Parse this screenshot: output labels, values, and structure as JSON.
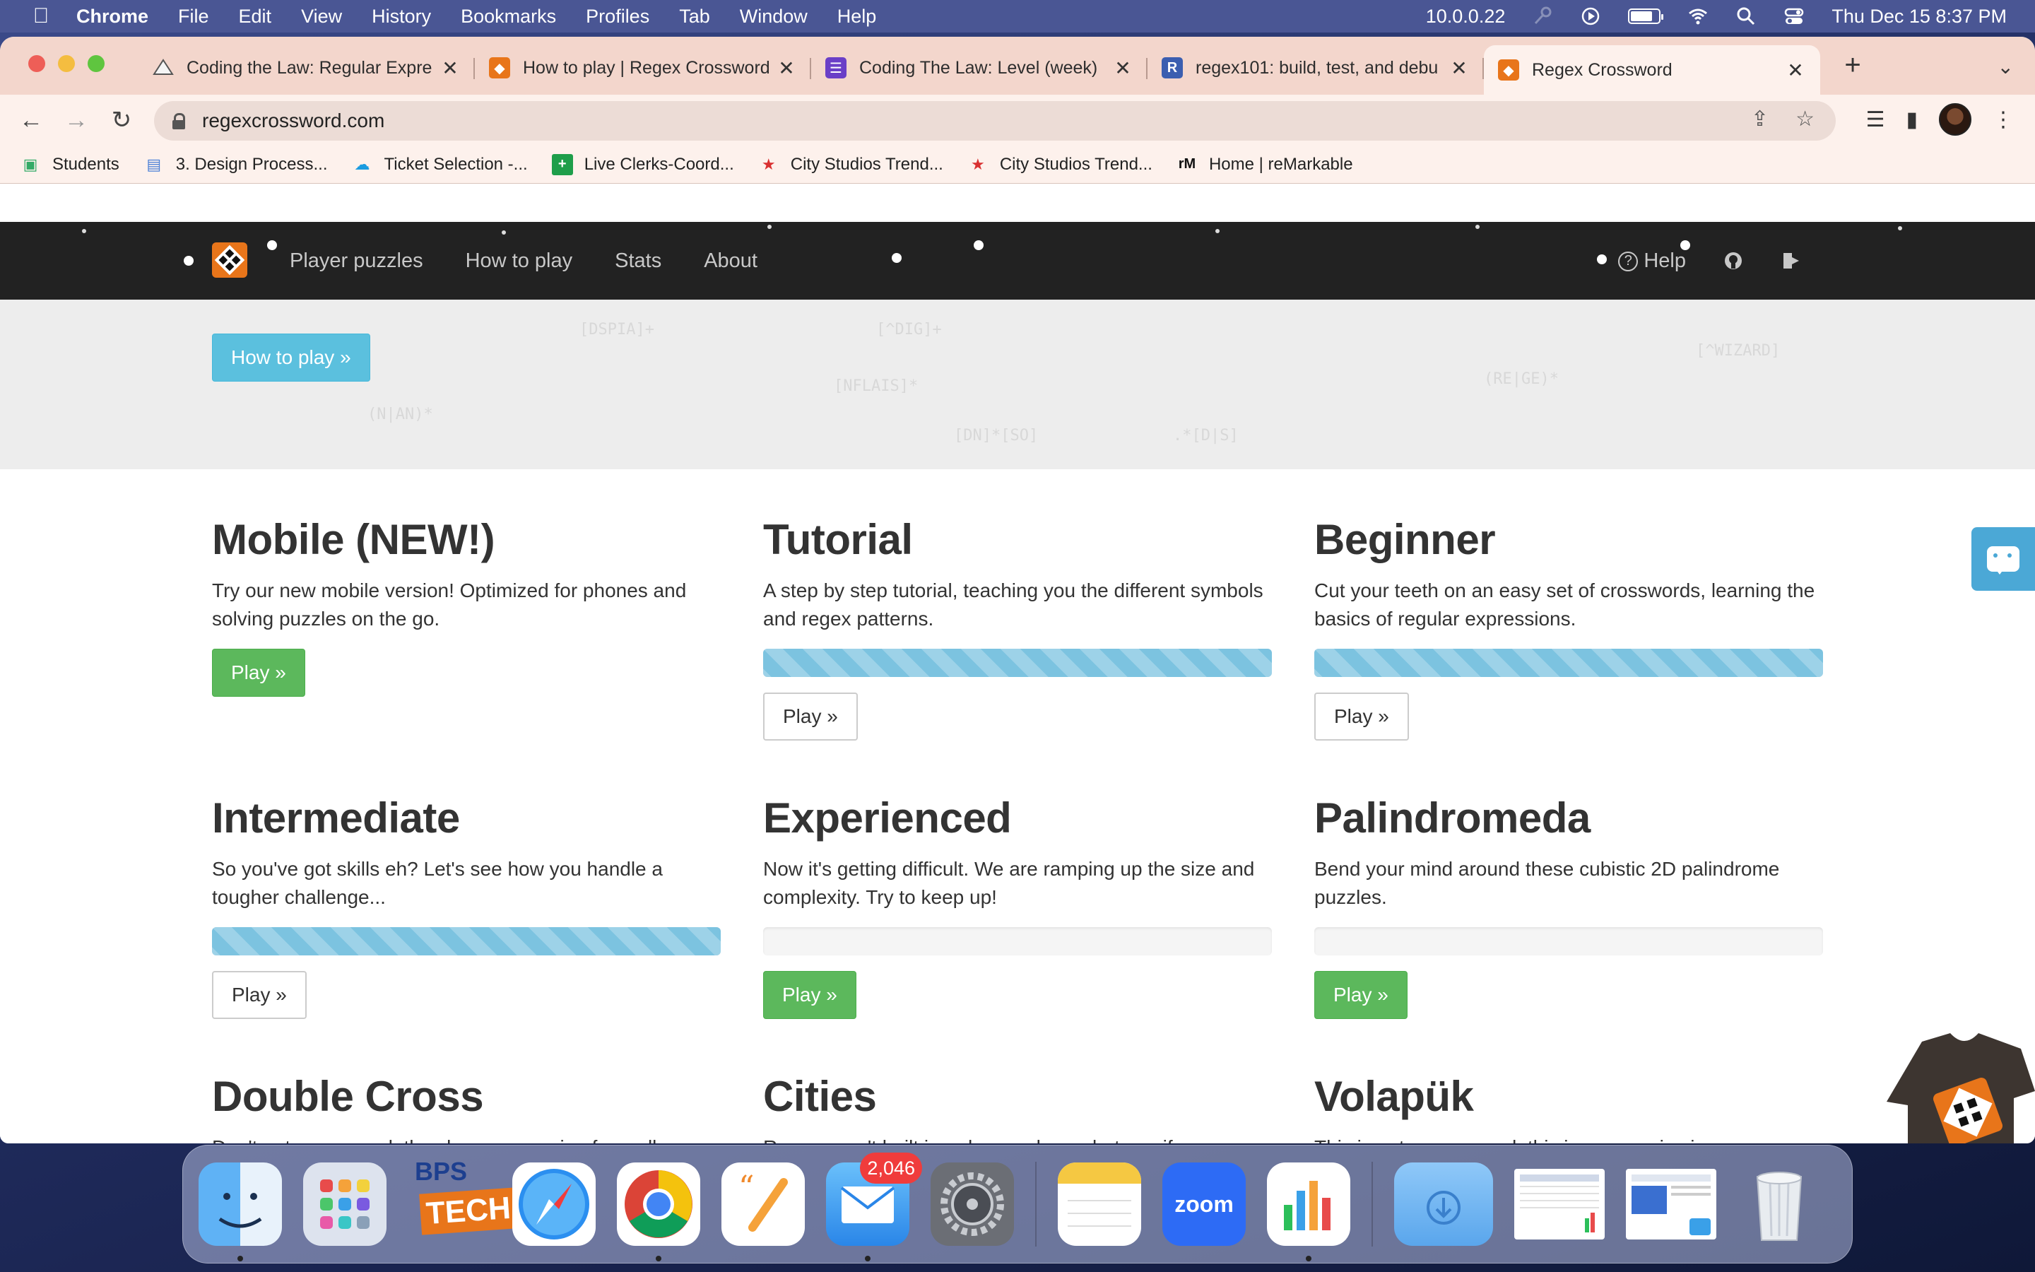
{
  "menubar": {
    "items": [
      "Chrome",
      "File",
      "Edit",
      "View",
      "History",
      "Bookmarks",
      "Profiles",
      "Tab",
      "Window",
      "Help"
    ],
    "ip": "10.0.0.22",
    "datetime": "Thu Dec 15  8:37 PM"
  },
  "tabs": [
    {
      "title": "Coding the Law: Regular Expre",
      "favicon": "drive-icon",
      "color": "#f0f0f0"
    },
    {
      "title": "How to play | Regex Crossword",
      "favicon": "regex-crossword-icon",
      "color": "#e8751a"
    },
    {
      "title": "Coding The Law: Level (week)",
      "favicon": "forms-icon",
      "color": "#6a3fc7"
    },
    {
      "title": "regex101: build, test, and debu",
      "favicon": "regex101-icon",
      "color": "#3b5eb0"
    },
    {
      "title": "Regex Crossword",
      "favicon": "regex-crossword-icon",
      "color": "#e8751a",
      "active": true
    }
  ],
  "address": {
    "url": "regexcrossword.com"
  },
  "bookmarks": [
    {
      "label": "Students",
      "icon": "students-icon",
      "color": "#3a6"
    },
    {
      "label": "3. Design Process...",
      "icon": "doc-icon",
      "color": "#4a7fd6"
    },
    {
      "label": "Ticket Selection -...",
      "icon": "cloud-icon",
      "color": "#1a9be0"
    },
    {
      "label": "Live Clerks-Coord...",
      "icon": "sheets-icon",
      "color": "#1e9e4a"
    },
    {
      "label": "City Studios Trend...",
      "icon": "star-icon",
      "color": "#d93030"
    },
    {
      "label": "City Studios Trend...",
      "icon": "star-icon",
      "color": "#d93030"
    },
    {
      "label": "Home | reMarkable",
      "icon": "remarkable-icon",
      "color": "#111"
    }
  ],
  "site": {
    "nav": [
      "Player puzzles",
      "How to play",
      "Stats",
      "About"
    ],
    "help": "Help",
    "hero_button": "How to play »",
    "cards": [
      {
        "title": "Mobile (NEW!)",
        "desc": "Try our new mobile version! Optimized for phones and solving puzzles on the go.",
        "progress": null,
        "button": "Play »",
        "style": "green"
      },
      {
        "title": "Tutorial",
        "desc": "A step by step tutorial, teaching you the different symbols and regex patterns.",
        "progress": 1.0,
        "button": "Play »",
        "style": "white"
      },
      {
        "title": "Beginner",
        "desc": "Cut your teeth on an easy set of crosswords, learning the basics of regular expressions.",
        "progress": 1.0,
        "button": "Play »",
        "style": "white"
      },
      {
        "title": "Intermediate",
        "desc": "So you've got skills eh? Let's see how you handle a tougher challenge...",
        "progress": 1.0,
        "button": "Play »",
        "style": "white"
      },
      {
        "title": "Experienced",
        "desc": "Now it's getting difficult. We are ramping up the size and complexity. Try to keep up!",
        "progress": 0.0,
        "button": "Play »",
        "style": "green"
      },
      {
        "title": "Palindromeda",
        "desc": "Bend your mind around these cubistic 2D palindrome puzzles.",
        "progress": 0.0,
        "button": "Play »",
        "style": "green"
      },
      {
        "title": "Double Cross",
        "desc": "Don't get cross-eyed, the clues are coming from all",
        "progress": null,
        "button": null,
        "style": null
      },
      {
        "title": "Cities",
        "desc": "Rome wasn't built in a day you know, but see if you can",
        "progress": null,
        "button": null,
        "style": null
      },
      {
        "title": "Volapük",
        "desc": "This is not a crossword, this is an exercise in pure regex",
        "progress": null,
        "button": null,
        "style": null
      }
    ]
  },
  "dock": {
    "apps": [
      "finder-icon",
      "launchpad-icon",
      "bps-tech-icon",
      "safari-icon",
      "chrome-icon",
      "pages-icon",
      "mail-icon",
      "system-preferences-icon",
      "notes-icon",
      "zoom-icon",
      "numbers-icon",
      "downloads-icon",
      "screenshot-icon",
      "screenshot-mail-icon",
      "trash-icon"
    ],
    "mail_badge": "2,046",
    "zoom_label": "zoom",
    "bps_label": "BPS",
    "tech_label": "TECH"
  }
}
